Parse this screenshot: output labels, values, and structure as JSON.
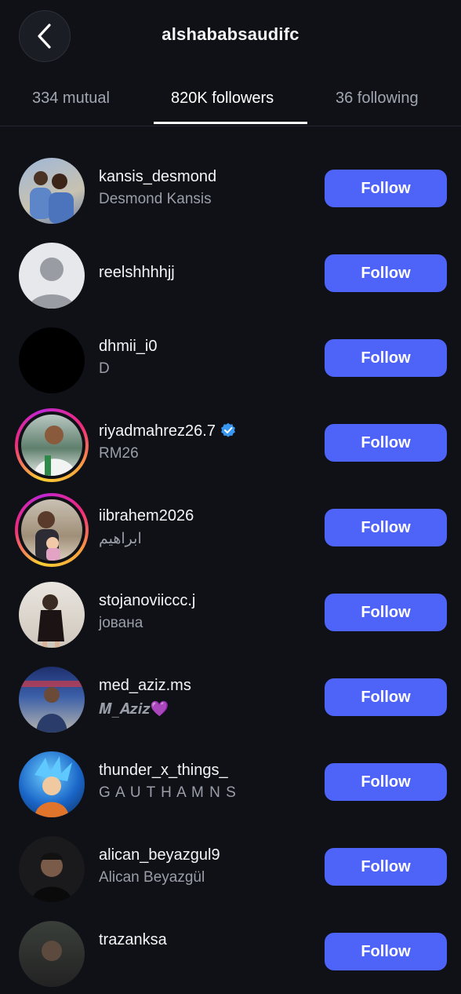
{
  "header": {
    "title": "alshababsaudifc"
  },
  "tabs": [
    {
      "label": "334 mutual"
    },
    {
      "label": "820K followers"
    },
    {
      "label": "36 following"
    }
  ],
  "users": [
    {
      "username": "kansis_desmond",
      "fullname": "Desmond Kansis",
      "button": "Follow"
    },
    {
      "username": "reelshhhhjj",
      "fullname": "",
      "button": "Follow"
    },
    {
      "username": "dhmii_i0",
      "fullname": "D",
      "button": "Follow"
    },
    {
      "username": "riyadmahrez26.7",
      "fullname": "RM26",
      "button": "Follow"
    },
    {
      "username": "iibrahem2026",
      "fullname": "ابراهيم",
      "button": "Follow"
    },
    {
      "username": "stojanoviiccc.j",
      "fullname": "јована",
      "button": "Follow"
    },
    {
      "username": "med_aziz.ms",
      "fullname": "𝑴_𝑨𝒛𝒊𝒛💜",
      "button": "Follow"
    },
    {
      "username": "thunder_x_things_",
      "fullname": "G A U T H A M  N S",
      "button": "Follow"
    },
    {
      "username": "alican_beyazgul9",
      "fullname": "Alican Beyazgül",
      "button": "Follow"
    },
    {
      "username": "trazanksa",
      "fullname": "",
      "button": "Follow"
    }
  ],
  "colors": {
    "accent": "#4e63f7",
    "background": "#0f1117",
    "verified": "#3897f0"
  }
}
